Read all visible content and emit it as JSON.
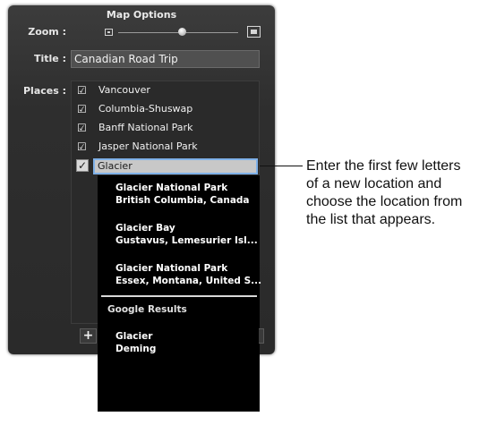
{
  "panel": {
    "title": "Map Options",
    "zoom_label": "Zoom :",
    "title_label": "Title :",
    "title_value": "Canadian Road Trip",
    "places_label": "Places :",
    "zoom_level": 0.55
  },
  "places": [
    {
      "label": "Vancouver",
      "checked": true
    },
    {
      "label": "Columbia-Shuswap",
      "checked": true
    },
    {
      "label": "Banff National Park",
      "checked": true
    },
    {
      "label": "Jasper National Park",
      "checked": true
    }
  ],
  "editing_place": {
    "value": "Glacier",
    "checked": true
  },
  "suggestions": [
    {
      "name": "Glacier National Park",
      "detail": "British Columbia, Canada"
    },
    {
      "name": "Glacier Bay",
      "detail": "Gustavus, Lemesurier Isl..."
    },
    {
      "name": "Glacier National Park",
      "detail": "Essex, Montana, United S..."
    }
  ],
  "google_results_header": "Google Results",
  "google_results": [
    {
      "name": "Glacier",
      "detail": "Deming"
    }
  ],
  "buttons": {
    "add": "+"
  },
  "callout": "Enter the first few letters of a new location and choose the location from the list that appears."
}
